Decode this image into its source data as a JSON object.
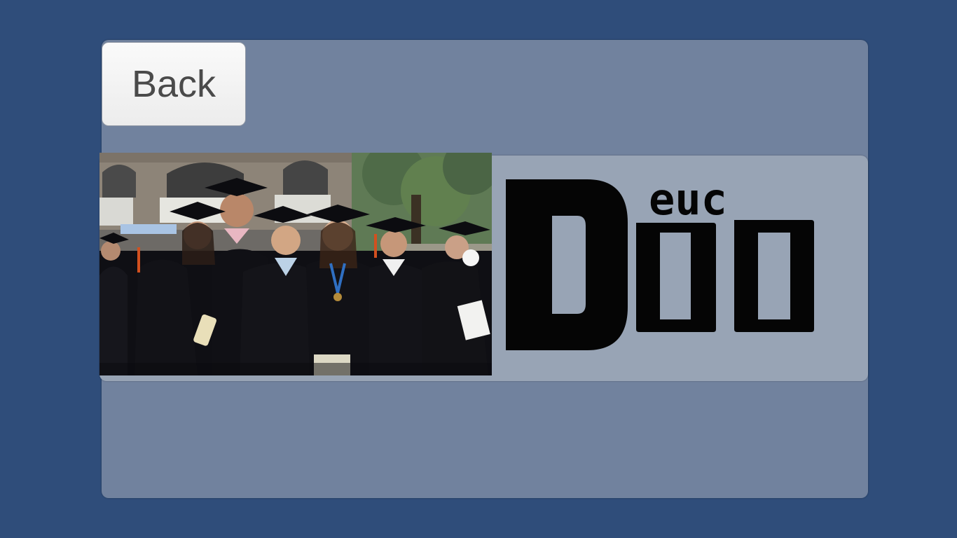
{
  "back_button": {
    "label": "Back"
  },
  "logo": {
    "big_letter": "D",
    "small_text": "euc",
    "letters": [
      "o",
      "o"
    ]
  },
  "photo": {
    "subject": "graduates-group-photo"
  },
  "colors": {
    "background": "#2f4d7a",
    "panel": "#71829e",
    "banner": "#98a4b5",
    "button": "#f4f4f4",
    "logo": "#050505"
  }
}
